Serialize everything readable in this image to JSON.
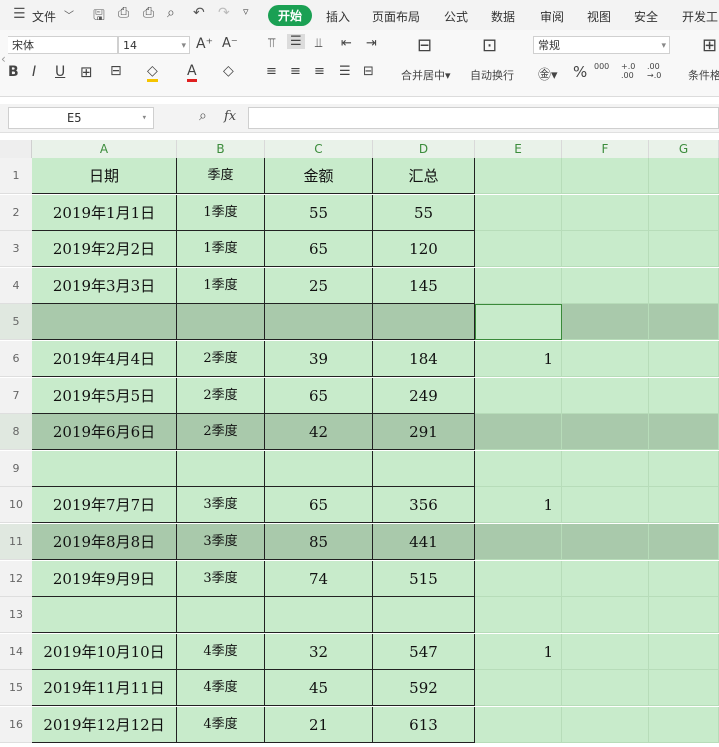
{
  "menubar": {
    "hamburger_icon": "menu-icon",
    "file": "文件",
    "tabs": [
      "开始",
      "插入",
      "页面布局",
      "公式",
      "数据",
      "审阅",
      "视图",
      "安全",
      "开发工"
    ]
  },
  "ribbon": {
    "font_name": "宋体",
    "font_size": "14",
    "number_format": "常规",
    "merge_label": "合并居中",
    "wrap_label": "自动换行",
    "cond_label": "条件格",
    "percent": "%",
    "thousands": "000",
    "inc_decimal": "+.0 .00",
    "dec_decimal": ".00 →.0"
  },
  "formula_bar": {
    "name_box": "E5",
    "fx": "fx",
    "formula": ""
  },
  "columns": [
    "A",
    "B",
    "C",
    "D",
    "E",
    "F",
    "G"
  ],
  "rows": [
    {
      "n": "1",
      "a": "日期",
      "b": "季度",
      "c": "金额",
      "d": "汇总",
      "e": "",
      "hl": false
    },
    {
      "n": "2",
      "a": "2019年1月1日",
      "b": "1季度",
      "c": "55",
      "d": "55",
      "e": "",
      "hl": false
    },
    {
      "n": "3",
      "a": "2019年2月2日",
      "b": "1季度",
      "c": "65",
      "d": "120",
      "e": "",
      "hl": false
    },
    {
      "n": "4",
      "a": "2019年3月3日",
      "b": "1季度",
      "c": "25",
      "d": "145",
      "e": "",
      "hl": false
    },
    {
      "n": "5",
      "a": "",
      "b": "",
      "c": "",
      "d": "",
      "e": "",
      "hl": true
    },
    {
      "n": "6",
      "a": "2019年4月4日",
      "b": "2季度",
      "c": "39",
      "d": "184",
      "e": "1",
      "hl": false
    },
    {
      "n": "7",
      "a": "2019年5月5日",
      "b": "2季度",
      "c": "65",
      "d": "249",
      "e": "",
      "hl": false
    },
    {
      "n": "8",
      "a": "2019年6月6日",
      "b": "2季度",
      "c": "42",
      "d": "291",
      "e": "",
      "hl": true
    },
    {
      "n": "9",
      "a": "",
      "b": "",
      "c": "",
      "d": "",
      "e": "",
      "hl": false
    },
    {
      "n": "10",
      "a": "2019年7月7日",
      "b": "3季度",
      "c": "65",
      "d": "356",
      "e": "1",
      "hl": false
    },
    {
      "n": "11",
      "a": "2019年8月8日",
      "b": "3季度",
      "c": "85",
      "d": "441",
      "e": "",
      "hl": true
    },
    {
      "n": "12",
      "a": "2019年9月9日",
      "b": "3季度",
      "c": "74",
      "d": "515",
      "e": "",
      "hl": false
    },
    {
      "n": "13",
      "a": "",
      "b": "",
      "c": "",
      "d": "",
      "e": "",
      "hl": false
    },
    {
      "n": "14",
      "a": "2019年10月10日",
      "b": "4季度",
      "c": "32",
      "d": "547",
      "e": "1",
      "hl": false
    },
    {
      "n": "15",
      "a": "2019年11月11日",
      "b": "4季度",
      "c": "45",
      "d": "592",
      "e": "",
      "hl": false
    },
    {
      "n": "16",
      "a": "2019年12月12日",
      "b": "4季度",
      "c": "21",
      "d": "613",
      "e": "",
      "hl": false
    }
  ]
}
